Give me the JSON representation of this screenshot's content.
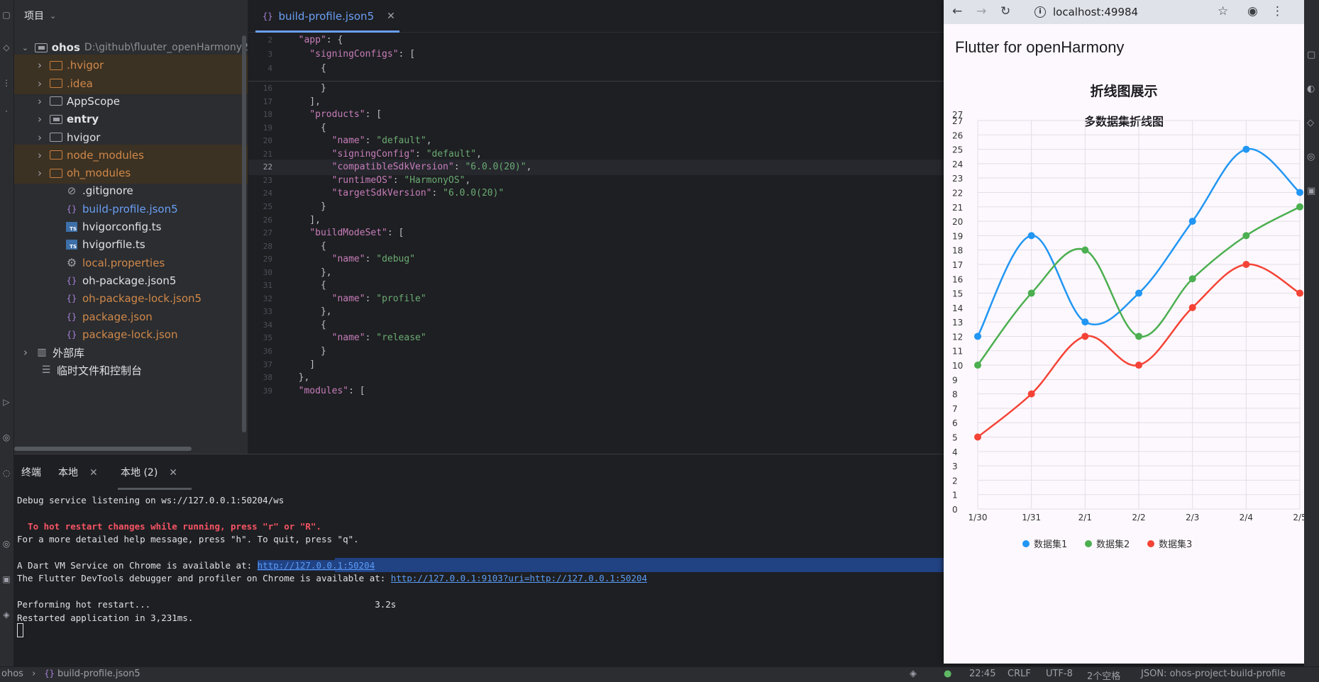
{
  "project": {
    "header": "项目",
    "items": [
      {
        "name": "ohos",
        "path": "D:\\github\\fluuter_openHarmony2",
        "type": "root"
      },
      {
        "name": ".hvigor",
        "type": "folder-excluded"
      },
      {
        "name": ".idea",
        "type": "folder-excluded"
      },
      {
        "name": "AppScope",
        "type": "folder"
      },
      {
        "name": "entry",
        "type": "module"
      },
      {
        "name": "hvigor",
        "type": "folder"
      },
      {
        "name": "node_modules",
        "type": "folder-excluded"
      },
      {
        "name": "oh_modules",
        "type": "folder-excluded"
      },
      {
        "name": ".gitignore",
        "type": "ignore-file"
      },
      {
        "name": "build-profile.json5",
        "type": "json-open"
      },
      {
        "name": "hvigorconfig.ts",
        "type": "ts"
      },
      {
        "name": "hvigorfile.ts",
        "type": "ts"
      },
      {
        "name": "local.properties",
        "type": "properties"
      },
      {
        "name": "oh-package.json5",
        "type": "json"
      },
      {
        "name": "oh-package-lock.json5",
        "type": "json-modified"
      },
      {
        "name": "package.json",
        "type": "json-modified"
      },
      {
        "name": "package-lock.json",
        "type": "json-modified"
      },
      {
        "name": "外部库",
        "type": "library"
      },
      {
        "name": "临时文件和控制台",
        "type": "scratch"
      }
    ]
  },
  "editor": {
    "tab_label": "build-profile.json5",
    "sticky": [
      {
        "ln": "2",
        "code": "  \"app\": {"
      },
      {
        "ln": "3",
        "code": "    \"signingConfigs\": ["
      },
      {
        "ln": "4",
        "code": "      {"
      }
    ],
    "lines": [
      {
        "ln": "16",
        "code": "      }"
      },
      {
        "ln": "17",
        "code": "    ],"
      },
      {
        "ln": "18",
        "code": "    \"products\": ["
      },
      {
        "ln": "19",
        "code": "      {"
      },
      {
        "ln": "20",
        "code": "        \"name\": \"default\","
      },
      {
        "ln": "21",
        "code": "        \"signingConfig\": \"default\","
      },
      {
        "ln": "22",
        "code": "        \"compatibleSdkVersion\": \"6.0.0(20)\","
      },
      {
        "ln": "23",
        "code": "        \"runtimeOS\": \"HarmonyOS\","
      },
      {
        "ln": "24",
        "code": "        \"targetSdkVersion\": \"6.0.0(20)\""
      },
      {
        "ln": "25",
        "code": "      }"
      },
      {
        "ln": "26",
        "code": "    ],"
      },
      {
        "ln": "27",
        "code": "    \"buildModeSet\": ["
      },
      {
        "ln": "28",
        "code": "      {"
      },
      {
        "ln": "29",
        "code": "        \"name\": \"debug\""
      },
      {
        "ln": "30",
        "code": "      },"
      },
      {
        "ln": "31",
        "code": "      {"
      },
      {
        "ln": "32",
        "code": "        \"name\": \"profile\""
      },
      {
        "ln": "33",
        "code": "      },"
      },
      {
        "ln": "34",
        "code": "      {"
      },
      {
        "ln": "35",
        "code": "        \"name\": \"release\""
      },
      {
        "ln": "36",
        "code": "      }"
      },
      {
        "ln": "37",
        "code": "    ]"
      },
      {
        "ln": "38",
        "code": "  },"
      },
      {
        "ln": "39",
        "code": "  \"modules\": ["
      }
    ]
  },
  "terminal": {
    "tabs": [
      "终端",
      "本地",
      "本地 (2)"
    ],
    "lines": [
      {
        "text": "Debug service listening on ws://127.0.0.1:50204/ws"
      },
      {
        "text": ""
      },
      {
        "text": "  To hot restart changes while running, press \"r\" or \"R\".",
        "style": "red"
      },
      {
        "text": "For a more detailed help message, press \"h\". To quit, press \"q\"."
      },
      {
        "text": ""
      },
      {
        "text": "A Dart VM Service on Chrome is available at: ",
        "link": "http://127.0.0.1:50204"
      },
      {
        "text": "The Flutter DevTools debugger and profiler on Chrome is available at: ",
        "link": "http://127.0.0.1:9103?uri=http://127.0.0.1:50204"
      },
      {
        "text": ""
      },
      {
        "text": "Performing hot restart...                                          3.2s"
      },
      {
        "text": "Restarted application in 3,231ms."
      }
    ]
  },
  "status": {
    "breadcrumb_root": "ohos",
    "breadcrumb_file": "build-profile.json5",
    "position": "22:45",
    "line_ending": "CRLF",
    "encoding": "UTF-8",
    "indent": "2个空格",
    "schema": "JSON: ohos-project-build-profile"
  },
  "browser": {
    "url": "localhost:49984",
    "app_title": "Flutter for openHarmony",
    "page_title": "折线图展示",
    "chart_title": "多数据集折线图"
  },
  "chart_data": {
    "type": "line",
    "title": "多数据集折线图",
    "categories": [
      "1/30",
      "1/31",
      "2/1",
      "2/2",
      "2/3",
      "2/4",
      "2/5"
    ],
    "ylim": [
      0,
      27
    ],
    "y_ticks": [
      "0",
      "1",
      "2",
      "3",
      "4",
      "5",
      "6",
      "7",
      "8",
      "9",
      "10",
      "11",
      "12",
      "13",
      "14",
      "15",
      "16",
      "17",
      "18",
      "19",
      "20",
      "21",
      "22",
      "23",
      "24",
      "25",
      "26",
      "27",
      "27"
    ],
    "grid": true,
    "legend_position": "bottom",
    "series": [
      {
        "name": "数据集1",
        "color": "#2196f3",
        "values": [
          12,
          19,
          13,
          15,
          20,
          25,
          22
        ]
      },
      {
        "name": "数据集2",
        "color": "#4caf50",
        "values": [
          10,
          15,
          18,
          12,
          16,
          19,
          21
        ]
      },
      {
        "name": "数据集3",
        "color": "#f44336",
        "values": [
          5,
          8,
          12,
          10,
          14,
          17,
          15
        ]
      }
    ]
  }
}
